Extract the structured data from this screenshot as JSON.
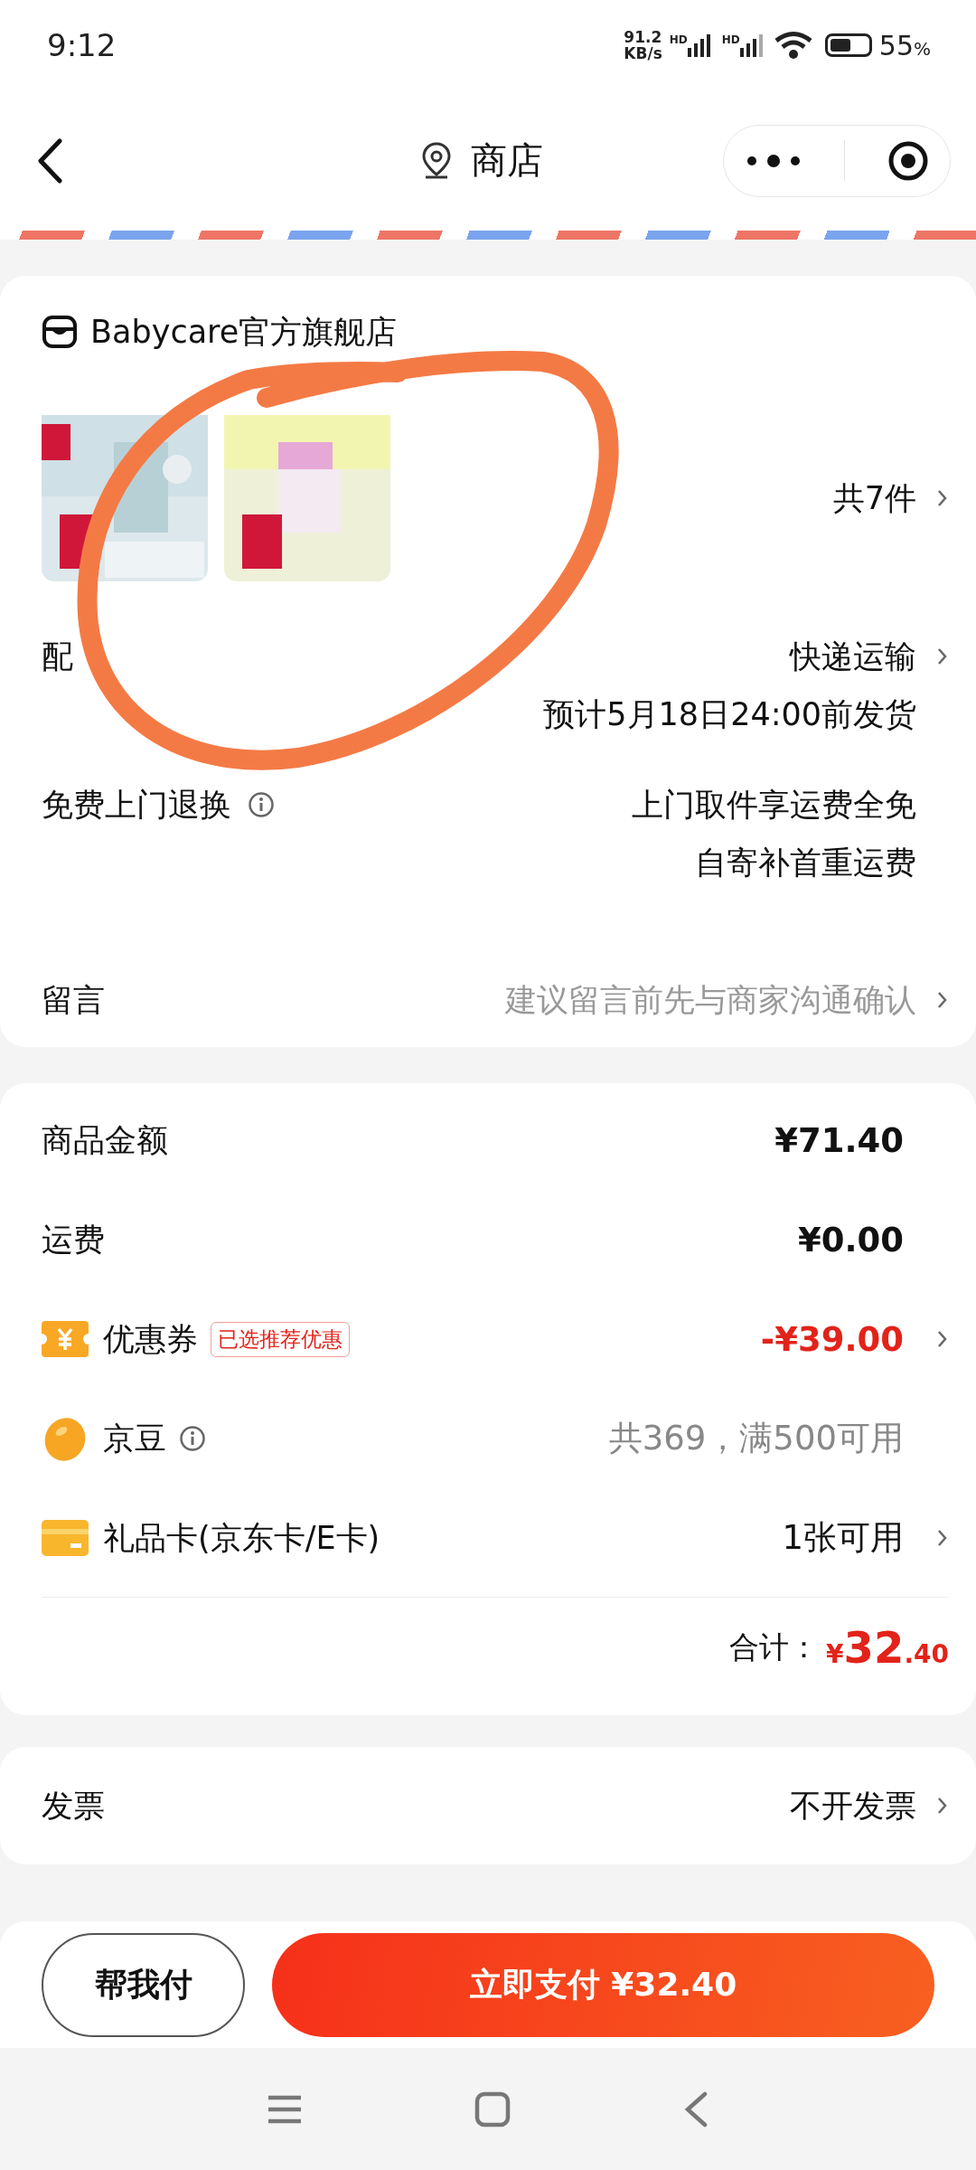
{
  "status_bar": {
    "time": "9:12",
    "net_speed": [
      "91.2",
      "KB/s"
    ],
    "signal_labels": [
      "HD",
      "HD"
    ],
    "battery": "55",
    "battery_unit": "%"
  },
  "nav": {
    "title": "商店"
  },
  "store": {
    "name": "Babycare官方旗舰店",
    "count": "共7件"
  },
  "order_rows": [
    {
      "kind": "detail",
      "label": "配",
      "lines": [
        "快递运输",
        "预计5月18日24:00前发货"
      ],
      "info": false,
      "chevron": true
    },
    {
      "kind": "detail",
      "label": "免费上门退换",
      "lines": [
        "上门取件享运费全免",
        "自寄补首重运费"
      ],
      "info": true,
      "chevron": false
    },
    {
      "kind": "message",
      "label": "留言",
      "placeholder": "建议留言前先与商家沟通确认",
      "info": false,
      "chevron": true
    }
  ],
  "price_rows": [
    {
      "kind": "plain",
      "label": "商品金额",
      "value": "¥71.40",
      "info": false,
      "chevron": false
    },
    {
      "kind": "plain",
      "label": "运费",
      "value": "¥0.00",
      "info": false,
      "chevron": false
    },
    {
      "kind": "coupon",
      "label": "优惠券",
      "tag": "已选推荐优惠",
      "value": "-¥39.00",
      "info": false,
      "chevron": true
    },
    {
      "kind": "bean",
      "label": "京豆",
      "value": "共369，满500可用",
      "info": true,
      "chevron": false
    },
    {
      "kind": "card",
      "label": "礼品卡(京东卡/E卡)",
      "value": "1张可用",
      "info": false,
      "chevron": true
    }
  ],
  "total": {
    "label": "合计：",
    "currency": "¥",
    "integer": "32",
    "decimal": ".40"
  },
  "invoice": {
    "label": "发票",
    "value": "不开发票"
  },
  "footer": {
    "secondary": "帮我付",
    "primary": "立即支付 ¥32.40"
  }
}
